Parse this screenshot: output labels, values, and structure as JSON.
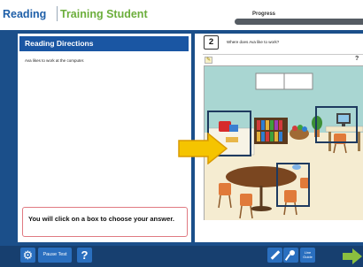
{
  "header": {
    "subject": "Reading",
    "student_name": "Training Student",
    "progress_label": "Progress"
  },
  "directions": {
    "title": "Reading Directions",
    "passage": "Ava likes to work at the computer.",
    "instruction": "You will click on a box to choose your answer."
  },
  "question": {
    "number": "2",
    "text": "Where does Ava like to work?",
    "help_mark": "?"
  },
  "toolbar": {
    "pause_label": "Pause Test",
    "help_label": "?",
    "line_guide_label": "Line Guide"
  },
  "colors": {
    "brand_blue": "#1a56a3",
    "frame_blue": "#1b4f8a",
    "subject_blue": "#1f5fa8",
    "student_green": "#6cae3c",
    "answer_box": "#1e3a5f",
    "pointer_arrow": "#f5c400",
    "next_arrow": "#8bbf3f"
  },
  "icons": [
    "gear-icon",
    "question-icon",
    "pencil-icon",
    "highlighter-icon",
    "line-guide-icon",
    "next-arrow-icon",
    "pointer-arrow-icon"
  ]
}
